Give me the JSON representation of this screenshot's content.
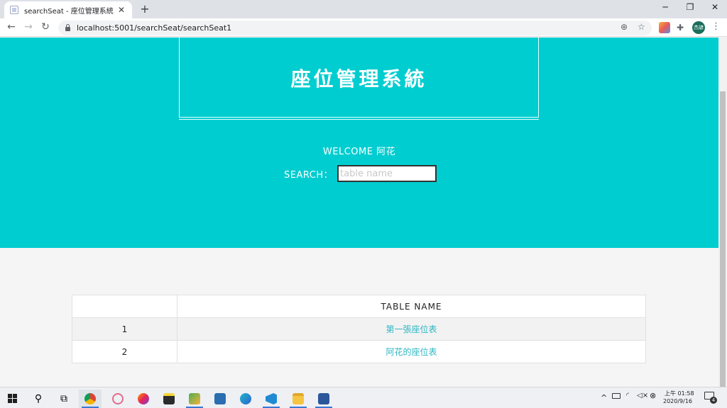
{
  "browser": {
    "tab_title": "searchSeat - 座位管理系統",
    "tab_close": "✕",
    "new_tab": "+",
    "window_controls": {
      "minimize": "─",
      "restore": "❐",
      "close": "✕"
    },
    "nav": {
      "back": "←",
      "forward": "→",
      "reload": "↻"
    },
    "url": "localhost:5001/searchSeat/searchSeat1",
    "zoom_icon": "⊕",
    "star_icon": "☆",
    "extensions_icon": "✚",
    "profile_label": "杰諺",
    "menu_icon": "⋮"
  },
  "page": {
    "site_title": "座位管理系統",
    "welcome_text": "WELCOME 阿花",
    "search_label": "SEARCH：",
    "search_placeholder": "table name",
    "search_value": "",
    "table": {
      "headers": [
        "",
        "TABLE NAME"
      ],
      "rows": [
        {
          "index": "1",
          "name": "第一張座位表"
        },
        {
          "index": "2",
          "name": "阿花的座位表"
        }
      ]
    }
  },
  "taskbar": {
    "time": "上午 01:58",
    "date": "2020/9/16",
    "notifications": "4",
    "search_icon": "⚲",
    "task_view_icon": "⧉"
  },
  "colors": {
    "hero_bg": "#00cdd0",
    "link_color": "#2fb7c4",
    "page_bg": "#f5f5f5"
  }
}
